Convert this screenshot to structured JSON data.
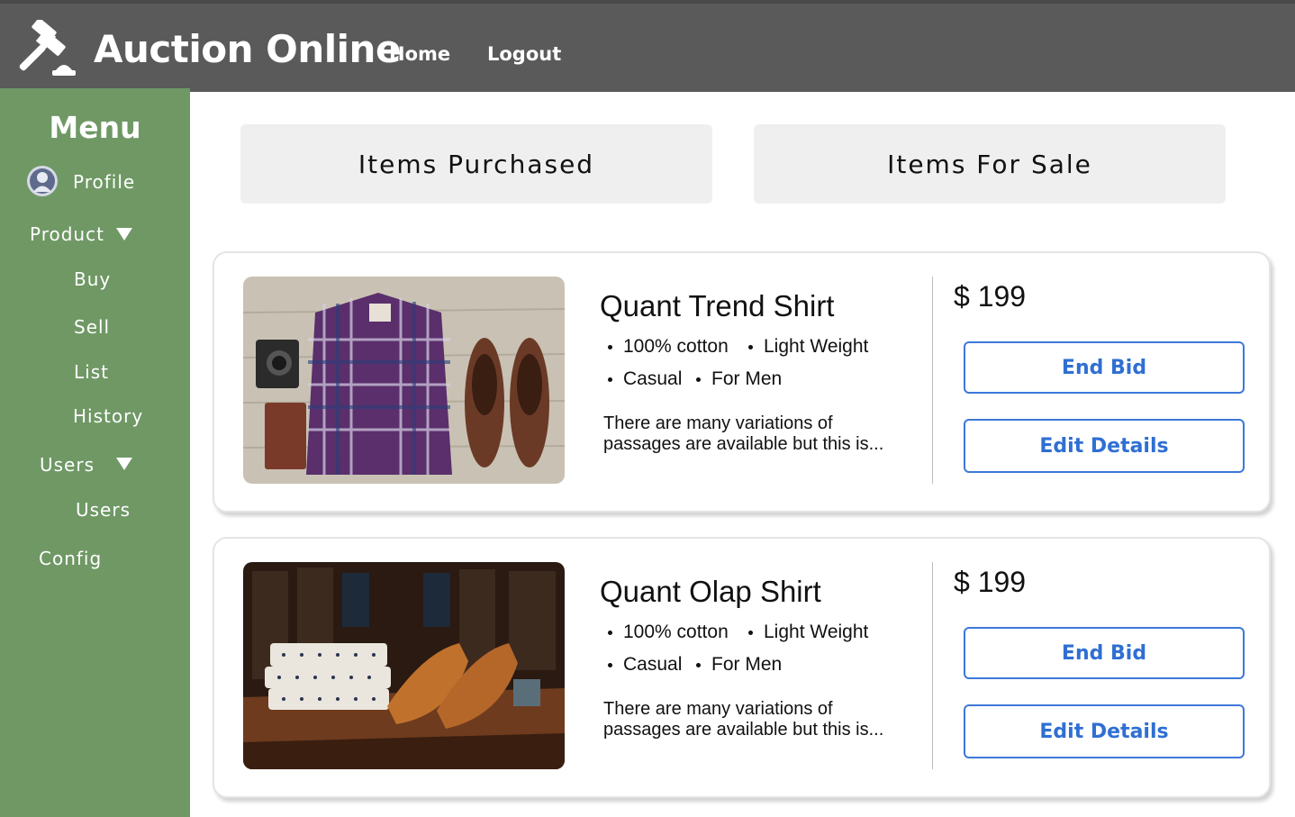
{
  "header": {
    "title": "Auction Online",
    "nav": {
      "home": "Home",
      "logout": "Logout"
    },
    "logo_icon": "gavel-icon"
  },
  "sidebar": {
    "title": "Menu",
    "profile": "Profile",
    "product": "Product",
    "product_items": [
      "Buy",
      "Sell",
      "List",
      "History"
    ],
    "users": "Users",
    "users_items": [
      "Users"
    ],
    "config": "Config"
  },
  "tabs": {
    "purchased": "Items Purchased",
    "for_sale": "Items For Sale"
  },
  "items": [
    {
      "name": "Quant Trend Shirt",
      "features": [
        "100% cotton",
        "Light Weight",
        "Casual",
        "For Men"
      ],
      "description": "There are many variations of passages are available but this is...",
      "price": "$ 199",
      "end_bid": "End Bid",
      "edit_details": "Edit Details"
    },
    {
      "name": "Quant Olap Shirt",
      "features": [
        "100% cotton",
        "Light Weight",
        "Casual",
        "For Men"
      ],
      "description": "There are many variations of passages are available but this is...",
      "price": "$ 199",
      "end_bid": "End Bid",
      "edit_details": "Edit Details"
    }
  ],
  "colors": {
    "header_bg": "#5a5a5a",
    "sidebar_bg": "#6f9865",
    "button_accent": "#2f6fd3",
    "tab_bg": "#efefef"
  }
}
